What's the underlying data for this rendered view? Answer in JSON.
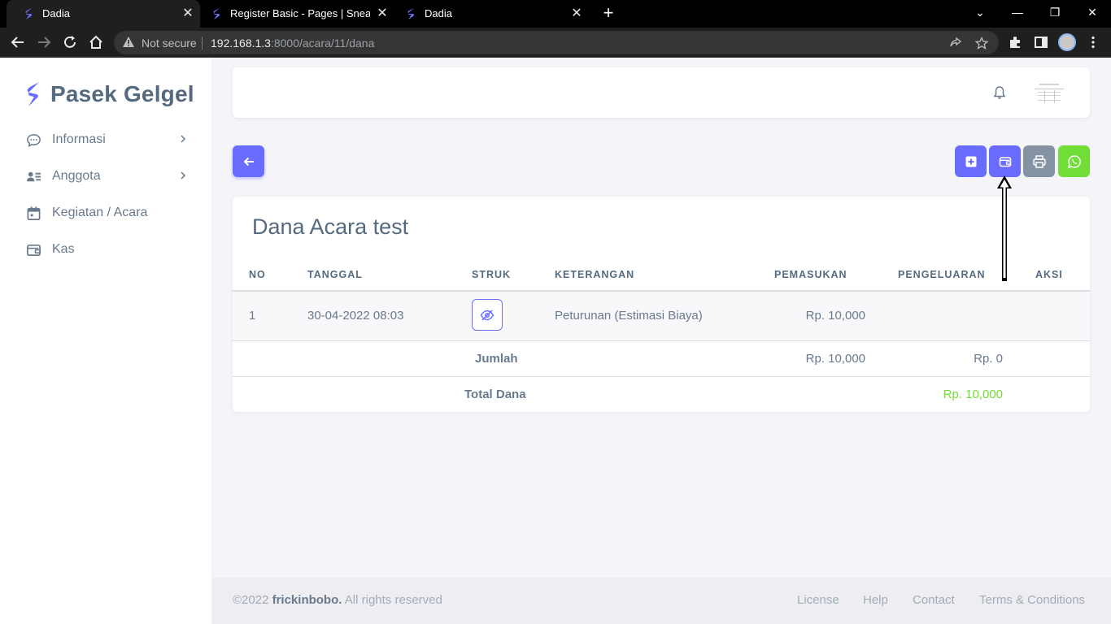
{
  "browser": {
    "tabs": [
      {
        "title": "Dadia",
        "active": true
      },
      {
        "title": "Register Basic - Pages | Sneat - B",
        "active": false
      },
      {
        "title": "Dadia",
        "active": false
      }
    ],
    "security_label": "Not secure",
    "url_host": "192.168.1.3",
    "url_path": ":8000/acara/11/dana"
  },
  "sidebar": {
    "brand": "Pasek Gelgel",
    "items": [
      {
        "label": "Informasi",
        "icon": "chat-icon",
        "has_submenu": true
      },
      {
        "label": "Anggota",
        "icon": "user-list-icon",
        "has_submenu": true
      },
      {
        "label": "Kegiatan / Acara",
        "icon": "calendar-icon",
        "has_submenu": false
      },
      {
        "label": "Kas",
        "icon": "wallet-icon",
        "has_submenu": false
      }
    ]
  },
  "actions": {
    "back_icon": "arrow-left-icon",
    "buttons": [
      {
        "name": "add",
        "icon": "plus-square-icon",
        "color": "#696cff"
      },
      {
        "name": "wallet",
        "icon": "wallet-icon",
        "color": "#696cff"
      },
      {
        "name": "print",
        "icon": "printer-icon",
        "color": "#8592a3"
      },
      {
        "name": "whatsapp",
        "icon": "whatsapp-icon",
        "color": "#71dd37"
      }
    ]
  },
  "card": {
    "title": "Dana Acara test",
    "columns": [
      "NO",
      "TANGGAL",
      "STRUK",
      "KETERANGAN",
      "PEMASUKAN",
      "PENGELUARAN",
      "AKSI"
    ],
    "rows": [
      {
        "no": "1",
        "tanggal": "30-04-2022 08:03",
        "struk_icon": "eye-off-icon",
        "keterangan": "Peturunan (Estimasi Biaya)",
        "pemasukan": "Rp. 10,000",
        "pengeluaran": ""
      }
    ],
    "jumlah": {
      "label": "Jumlah",
      "pemasukan": "Rp. 10,000",
      "pengeluaran": "Rp. 0"
    },
    "total": {
      "label": "Total Dana",
      "value": "Rp. 10,000"
    }
  },
  "footer": {
    "year": "©2022",
    "author": "frickinbobo.",
    "rights": "All rights reserved",
    "links": [
      "License",
      "Help",
      "Contact",
      "Terms & Conditions"
    ]
  },
  "colors": {
    "primary": "#696cff",
    "secondary": "#8592a3",
    "success": "#71dd37",
    "text": "#697a8d",
    "heading": "#566a7f"
  }
}
